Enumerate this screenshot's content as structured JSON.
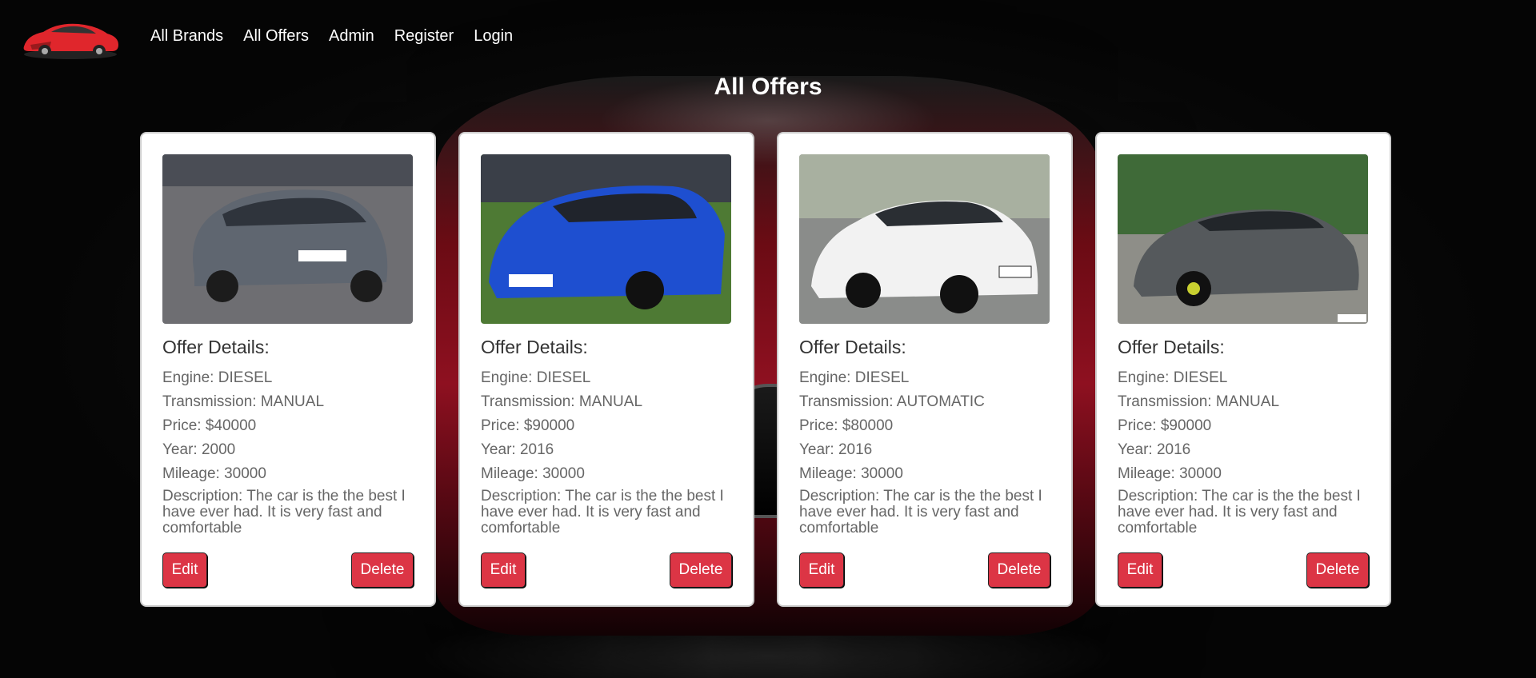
{
  "nav": {
    "links": [
      "All Brands",
      "All Offers",
      "Admin",
      "Register",
      "Login"
    ]
  },
  "page": {
    "title": "All Offers"
  },
  "offers": [
    {
      "heading": "Offer Details:",
      "engine": "Engine: DIESEL",
      "transmission": "Transmission: MANUAL",
      "price": "Price: $40000",
      "year": "Year: 2000",
      "mileage": "Mileage: 30000",
      "description": "Description: The car is the the best I have ever had. It is very fast and comfortable",
      "edit_label": "Edit",
      "delete_label": "Delete",
      "car_color": "#5f6670"
    },
    {
      "heading": "Offer Details:",
      "engine": "Engine: DIESEL",
      "transmission": "Transmission: MANUAL",
      "price": "Price: $90000",
      "year": "Year: 2016",
      "mileage": "Mileage: 30000",
      "description": "Description: The car is the the best I have ever had. It is very fast and comfortable",
      "edit_label": "Edit",
      "delete_label": "Delete",
      "car_color": "#1e4fd0"
    },
    {
      "heading": "Offer Details:",
      "engine": "Engine: DIESEL",
      "transmission": "Transmission: AUTOMATIC",
      "price": "Price: $80000",
      "year": "Year: 2016",
      "mileage": "Mileage: 30000",
      "description": "Description: The car is the the best I have ever had. It is very fast and comfortable",
      "edit_label": "Edit",
      "delete_label": "Delete",
      "car_color": "#f2f2f2"
    },
    {
      "heading": "Offer Details:",
      "engine": "Engine: DIESEL",
      "transmission": "Transmission: MANUAL",
      "price": "Price: $90000",
      "year": "Year: 2016",
      "mileage": "Mileage: 30000",
      "description": "Description: The car is the the best I have ever had. It is very fast and comfortable",
      "edit_label": "Edit",
      "delete_label": "Delete",
      "car_color": "#55595c"
    }
  ],
  "colors": {
    "accent": "#dc3545",
    "logo_car": "#e0262c"
  }
}
